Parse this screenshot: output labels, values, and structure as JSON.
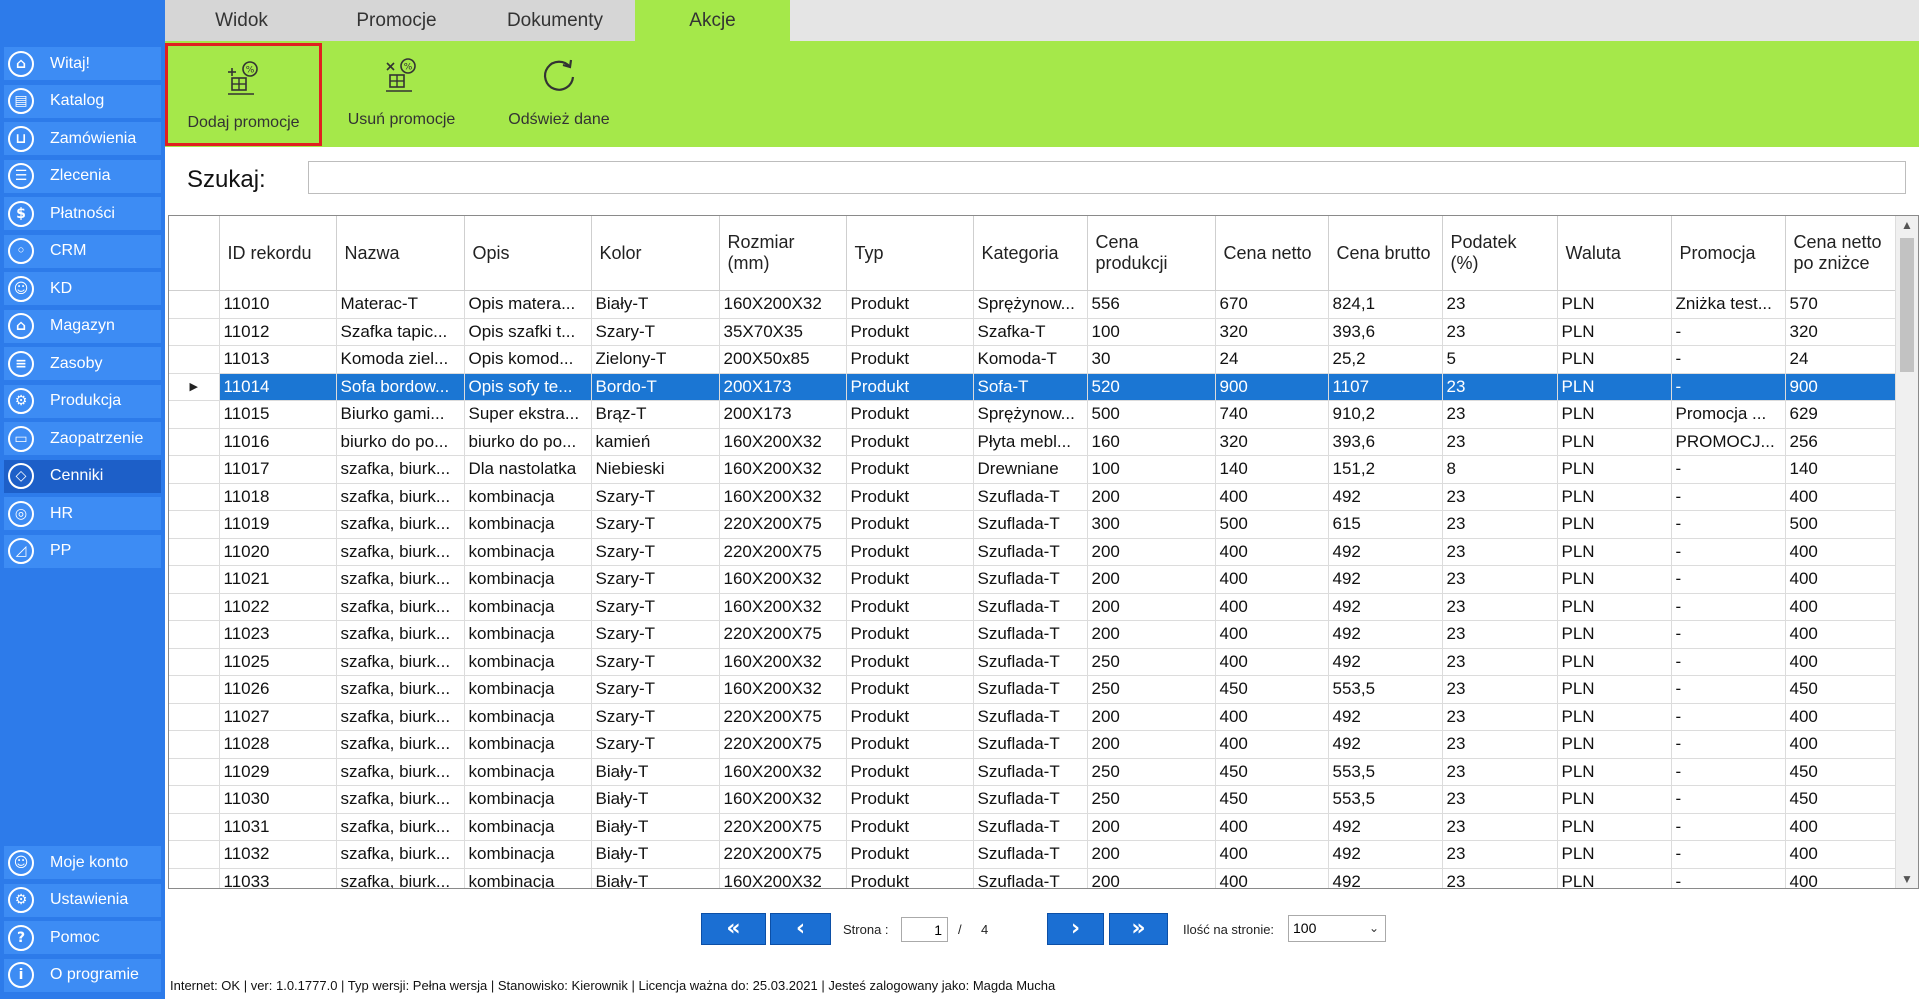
{
  "sidebar": {
    "items": [
      {
        "label": "Witaj!",
        "icon": "home-icon",
        "glyph": "⌂"
      },
      {
        "label": "Katalog",
        "icon": "book-icon",
        "glyph": "▤"
      },
      {
        "label": "Zamówienia",
        "icon": "cart-icon",
        "glyph": "⊔"
      },
      {
        "label": "Zlecenia",
        "icon": "list-icon",
        "glyph": "☰"
      },
      {
        "label": "Płatności",
        "icon": "dollar-icon",
        "glyph": "$"
      },
      {
        "label": "CRM",
        "icon": "crm-icon",
        "glyph": "◦"
      },
      {
        "label": "KD",
        "icon": "user-icon",
        "glyph": "☺"
      },
      {
        "label": "Magazyn",
        "icon": "warehouse-icon",
        "glyph": "⌂"
      },
      {
        "label": "Zasoby",
        "icon": "database-icon",
        "glyph": "≡"
      },
      {
        "label": "Produkcja",
        "icon": "production-icon",
        "glyph": "⚙"
      },
      {
        "label": "Zaopatrzenie",
        "icon": "truck-icon",
        "glyph": "▭"
      },
      {
        "label": "Cenniki",
        "icon": "tag-icon",
        "glyph": "◇"
      },
      {
        "label": "HR",
        "icon": "hr-icon",
        "glyph": "◎"
      },
      {
        "label": "PP",
        "icon": "chart-icon",
        "glyph": "◿"
      }
    ],
    "active_index": 11,
    "bottom_items": [
      {
        "label": "Moje konto",
        "icon": "account-icon",
        "glyph": "☺"
      },
      {
        "label": "Ustawienia",
        "icon": "settings-icon",
        "glyph": "⚙"
      },
      {
        "label": "Pomoc",
        "icon": "help-icon",
        "glyph": "?"
      },
      {
        "label": "O programie",
        "icon": "info-icon",
        "glyph": "i"
      }
    ]
  },
  "tabs": [
    {
      "label": "Widok",
      "active": false
    },
    {
      "label": "Promocje",
      "active": false
    },
    {
      "label": "Dokumenty",
      "active": false
    },
    {
      "label": "Akcje",
      "active": true
    }
  ],
  "ribbon": {
    "buttons": [
      {
        "label": "Dodaj promocje",
        "icon": "add-promotion-icon",
        "selected": true
      },
      {
        "label": "Usuń promocje",
        "icon": "remove-promotion-icon",
        "selected": false
      },
      {
        "label": "Odśwież dane",
        "icon": "refresh-icon",
        "selected": false
      }
    ]
  },
  "search": {
    "label": "Szukaj:",
    "value": "",
    "placeholder": ""
  },
  "grid": {
    "columns": [
      "ID rekordu",
      "Nazwa",
      "Opis",
      "Kolor",
      "Rozmiar (mm)",
      "Typ",
      "Kategoria",
      "Cena produkcji",
      "Cena netto",
      "Cena brutto",
      "Podatek (%)",
      "Waluta",
      "Promocja",
      "Cena netto po zniżce"
    ],
    "selected_row": 3,
    "row_indicator": "▶",
    "rows": [
      [
        "11010",
        "Materac-T",
        "Opis matera...",
        "Biały-T",
        "160X200X32",
        "Produkt",
        "Sprężynow...",
        "556",
        "670",
        "824,1",
        "23",
        "PLN",
        "Zniżka test...",
        "570"
      ],
      [
        "11012",
        "Szafka tapic...",
        "Opis szafki t...",
        "Szary-T",
        "35X70X35",
        "Produkt",
        "Szafka-T",
        "100",
        "320",
        "393,6",
        "23",
        "PLN",
        "-",
        "320"
      ],
      [
        "11013",
        "Komoda ziel...",
        "Opis komod...",
        "Zielony-T",
        "200X50x85",
        "Produkt",
        "Komoda-T",
        "30",
        "24",
        "25,2",
        "5",
        "PLN",
        "-",
        "24"
      ],
      [
        "11014",
        "Sofa bordow...",
        "Opis sofy te...",
        "Bordo-T",
        "200X173",
        "Produkt",
        "Sofa-T",
        "520",
        "900",
        "1107",
        "23",
        "PLN",
        "-",
        "900"
      ],
      [
        "11015",
        "Biurko gami...",
        "Super ekstra...",
        "Brąz-T",
        "200X173",
        "Produkt",
        "Sprężynow...",
        "500",
        "740",
        "910,2",
        "23",
        "PLN",
        "Promocja ...",
        "629"
      ],
      [
        "11016",
        "biurko do po...",
        "biurko do po...",
        "kamień",
        "160X200X32",
        "Produkt",
        "Płyta mebl...",
        "160",
        "320",
        "393,6",
        "23",
        "PLN",
        "PROMOCJ...",
        "256"
      ],
      [
        "11017",
        "szafka, biurk...",
        "Dla nastolatka",
        "Niebieski",
        "160X200X32",
        "Produkt",
        "Drewniane",
        "100",
        "140",
        "151,2",
        "8",
        "PLN",
        "-",
        "140"
      ],
      [
        "11018",
        "szafka, biurk...",
        "kombinacja",
        "Szary-T",
        "160X200X32",
        "Produkt",
        "Szuflada-T",
        "200",
        "400",
        "492",
        "23",
        "PLN",
        "-",
        "400"
      ],
      [
        "11019",
        "szafka, biurk...",
        "kombinacja",
        "Szary-T",
        "220X200X75",
        "Produkt",
        "Szuflada-T",
        "300",
        "500",
        "615",
        "23",
        "PLN",
        "-",
        "500"
      ],
      [
        "11020",
        "szafka, biurk...",
        "kombinacja",
        "Szary-T",
        "220X200X75",
        "Produkt",
        "Szuflada-T",
        "200",
        "400",
        "492",
        "23",
        "PLN",
        "-",
        "400"
      ],
      [
        "11021",
        "szafka, biurk...",
        "kombinacja",
        "Szary-T",
        "160X200X32",
        "Produkt",
        "Szuflada-T",
        "200",
        "400",
        "492",
        "23",
        "PLN",
        "-",
        "400"
      ],
      [
        "11022",
        "szafka, biurk...",
        "kombinacja",
        "Szary-T",
        "160X200X32",
        "Produkt",
        "Szuflada-T",
        "200",
        "400",
        "492",
        "23",
        "PLN",
        "-",
        "400"
      ],
      [
        "11023",
        "szafka, biurk...",
        "kombinacja",
        "Szary-T",
        "220X200X75",
        "Produkt",
        "Szuflada-T",
        "200",
        "400",
        "492",
        "23",
        "PLN",
        "-",
        "400"
      ],
      [
        "11025",
        "szafka, biurk...",
        "kombinacja",
        "Szary-T",
        "160X200X32",
        "Produkt",
        "Szuflada-T",
        "250",
        "400",
        "492",
        "23",
        "PLN",
        "-",
        "400"
      ],
      [
        "11026",
        "szafka, biurk...",
        "kombinacja",
        "Szary-T",
        "160X200X32",
        "Produkt",
        "Szuflada-T",
        "250",
        "450",
        "553,5",
        "23",
        "PLN",
        "-",
        "450"
      ],
      [
        "11027",
        "szafka, biurk...",
        "kombinacja",
        "Szary-T",
        "220X200X75",
        "Produkt",
        "Szuflada-T",
        "200",
        "400",
        "492",
        "23",
        "PLN",
        "-",
        "400"
      ],
      [
        "11028",
        "szafka, biurk...",
        "kombinacja",
        "Szary-T",
        "220X200X75",
        "Produkt",
        "Szuflada-T",
        "200",
        "400",
        "492",
        "23",
        "PLN",
        "-",
        "400"
      ],
      [
        "11029",
        "szafka, biurk...",
        "kombinacja",
        "Biały-T",
        "160X200X32",
        "Produkt",
        "Szuflada-T",
        "250",
        "450",
        "553,5",
        "23",
        "PLN",
        "-",
        "450"
      ],
      [
        "11030",
        "szafka, biurk...",
        "kombinacja",
        "Biały-T",
        "160X200X32",
        "Produkt",
        "Szuflada-T",
        "250",
        "450",
        "553,5",
        "23",
        "PLN",
        "-",
        "450"
      ],
      [
        "11031",
        "szafka, biurk...",
        "kombinacja",
        "Biały-T",
        "220X200X75",
        "Produkt",
        "Szuflada-T",
        "200",
        "400",
        "492",
        "23",
        "PLN",
        "-",
        "400"
      ],
      [
        "11032",
        "szafka, biurk...",
        "kombinacja",
        "Biały-T",
        "220X200X75",
        "Produkt",
        "Szuflada-T",
        "200",
        "400",
        "492",
        "23",
        "PLN",
        "-",
        "400"
      ],
      [
        "11033",
        "szafka, biurk...",
        "kombinacja",
        "Biały-T",
        "160X200X32",
        "Produkt",
        "Szuflada-T",
        "200",
        "400",
        "492",
        "23",
        "PLN",
        "-",
        "400"
      ]
    ]
  },
  "pager": {
    "first": "«",
    "prev": "‹",
    "next": "›",
    "last": "»",
    "page_label": "Strona :",
    "current_page": "1",
    "separator": "/",
    "total_pages": "4",
    "per_page_label": "Ilość na stronie:",
    "per_page_value": "100"
  },
  "status": {
    "text": "Internet: OK  |   ver: 1.0.1777.0   |   Typ wersji: Pełna wersja   |   Stanowisko: Kierownik   |   Licencja ważna do: 25.03.2021   |   Jesteś zalogowany jako: Magda Mucha"
  },
  "colors": {
    "sidebar": "#2d7bea",
    "ribbon": "#a5e84a",
    "selection": "#1b76d3",
    "highlight": "#e02020"
  }
}
